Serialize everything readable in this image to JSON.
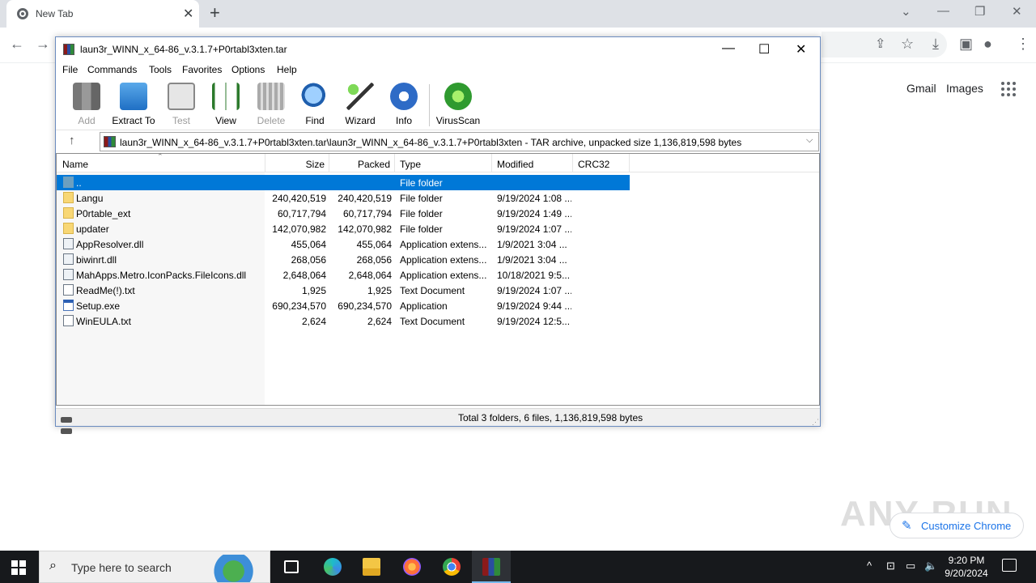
{
  "chrome": {
    "tab_title": "New Tab",
    "google_links": [
      "Gmail",
      "Images"
    ],
    "customize_label": "Customize Chrome",
    "watermark": "ANY RUN"
  },
  "winrar": {
    "title": "laun3r_WINN_x_64-86_v.3.1.7+P0rtabl3xten.tar",
    "menu": [
      "File",
      "Commands",
      "Tools",
      "Favorites",
      "Options",
      "Help"
    ],
    "toolbar": [
      {
        "label": "Add",
        "icon": "add-archive-icon",
        "enabled": false
      },
      {
        "label": "Extract To",
        "icon": "extract-folder-icon",
        "enabled": true
      },
      {
        "label": "Test",
        "icon": "test-clipboard-icon",
        "enabled": false
      },
      {
        "label": "View",
        "icon": "view-book-icon",
        "enabled": true
      },
      {
        "label": "Delete",
        "icon": "trash-icon",
        "enabled": false
      },
      {
        "label": "Find",
        "icon": "magnifier-icon",
        "enabled": true
      },
      {
        "label": "Wizard",
        "icon": "wand-icon",
        "enabled": true
      },
      {
        "label": "Info",
        "icon": "info-icon",
        "enabled": true
      },
      {
        "label": "VirusScan",
        "icon": "virus-scan-icon",
        "enabled": true
      }
    ],
    "path": "laun3r_WINN_x_64-86_v.3.1.7+P0rtabl3xten.tar\\laun3r_WINN_x_64-86_v.3.1.7+P0rtabl3xten - TAR archive, unpacked size 1,136,819,598 bytes",
    "columns": [
      "Name",
      "Size",
      "Packed",
      "Type",
      "Modified",
      "CRC32"
    ],
    "files": [
      {
        "name": "..",
        "size": "",
        "packed": "",
        "type": "File folder",
        "modified": "",
        "icon": "up",
        "selected": true
      },
      {
        "name": "Langu",
        "size": "240,420,519",
        "packed": "240,420,519",
        "type": "File folder",
        "modified": "9/19/2024 1:08 ...",
        "icon": "folder"
      },
      {
        "name": "P0rtable_ext",
        "size": "60,717,794",
        "packed": "60,717,794",
        "type": "File folder",
        "modified": "9/19/2024 1:49 ...",
        "icon": "folder"
      },
      {
        "name": "updater",
        "size": "142,070,982",
        "packed": "142,070,982",
        "type": "File folder",
        "modified": "9/19/2024 1:07 ...",
        "icon": "folder"
      },
      {
        "name": "AppResolver.dll",
        "size": "455,064",
        "packed": "455,064",
        "type": "Application extens...",
        "modified": "1/9/2021 3:04 ...",
        "icon": "dll"
      },
      {
        "name": "biwinrt.dll",
        "size": "268,056",
        "packed": "268,056",
        "type": "Application extens...",
        "modified": "1/9/2021 3:04 ...",
        "icon": "dll"
      },
      {
        "name": "MahApps.Metro.IconPacks.FileIcons.dll",
        "size": "2,648,064",
        "packed": "2,648,064",
        "type": "Application extens...",
        "modified": "10/18/2021 9:5...",
        "icon": "dll"
      },
      {
        "name": "ReadMe(!).txt",
        "size": "1,925",
        "packed": "1,925",
        "type": "Text Document",
        "modified": "9/19/2024 1:07 ...",
        "icon": "txt"
      },
      {
        "name": "Setup.exe",
        "size": "690,234,570",
        "packed": "690,234,570",
        "type": "Application",
        "modified": "9/19/2024 9:44 ...",
        "icon": "exe"
      },
      {
        "name": "WinEULA.txt",
        "size": "2,624",
        "packed": "2,624",
        "type": "Text Document",
        "modified": "9/19/2024 12:5...",
        "icon": "txt"
      }
    ],
    "status": "Total 3 folders, 6 files, 1,136,819,598 bytes"
  },
  "taskbar": {
    "search_placeholder": "Type here to search",
    "time": "9:20 PM",
    "date": "9/20/2024"
  }
}
